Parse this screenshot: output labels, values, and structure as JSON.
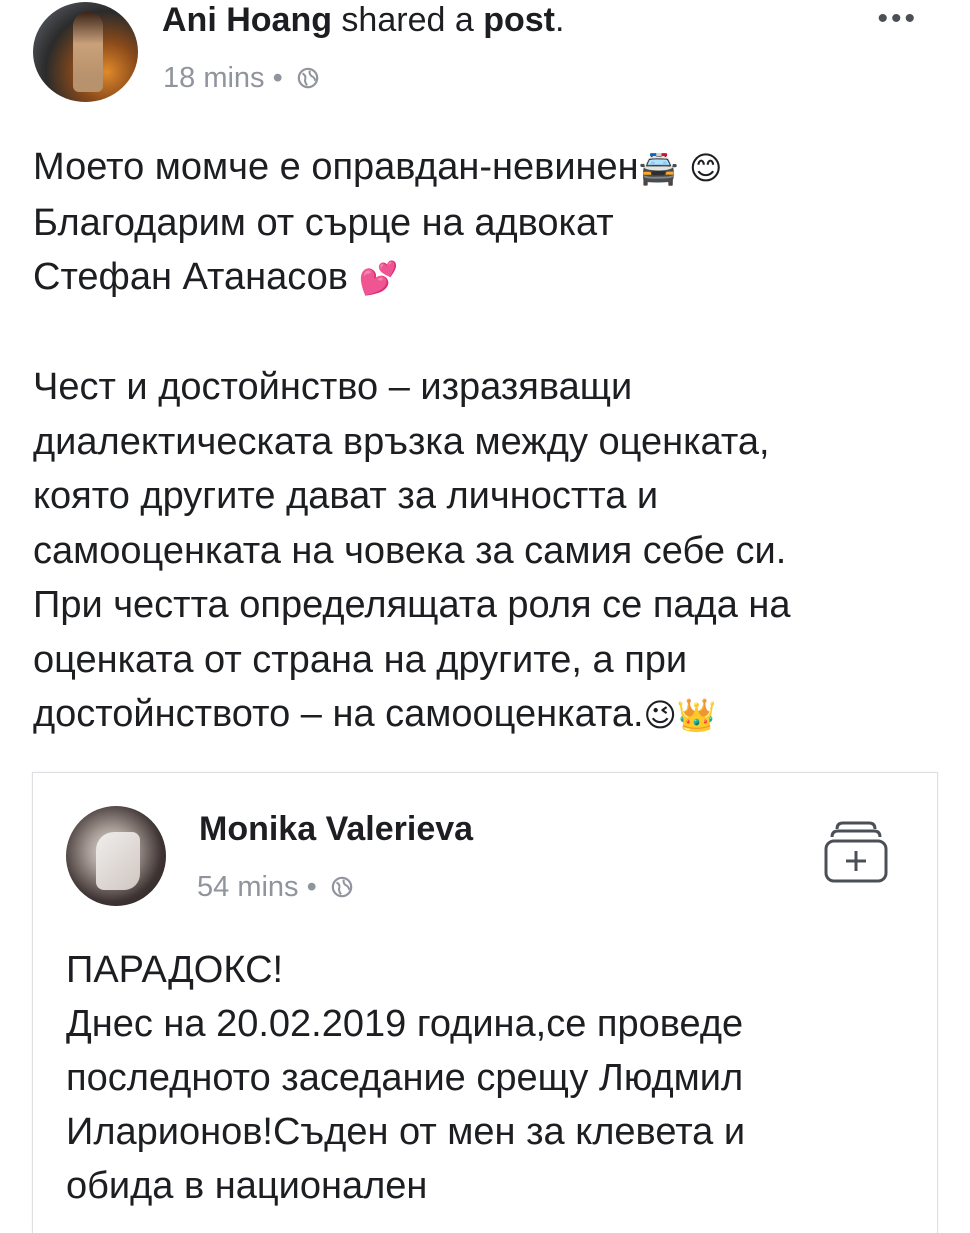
{
  "post": {
    "author": "Ani Hoang",
    "action_prefix": " shared a ",
    "action_object": "post",
    "action_suffix": ".",
    "time": "18 mins",
    "dot": " • ",
    "privacy_icon": "globe-icon",
    "more_label": "•••",
    "text_line1": "Моето момче е оправдан-невинен",
    "emoji1": "🚔",
    "emoji2": "😊",
    "text_line2": "Благодарим от сърце на адвокат",
    "text_line3": "Стефан Атанасов ",
    "emoji3": "💕",
    "paragraph2": "Чест и достойнство –  изразяващи\nдиалектическата връзка между оценката,\nкоято другите дават за личността и\nсамооценката на човека за самия себе си.\nПри честта определящата роля се пада на\nоценката от страна на другите, а при\nдостойнството – на самооценката.",
    "emoji4": "😉",
    "emoji5": "👑"
  },
  "shared": {
    "author": "Monika Valerieva",
    "time": "54 mins",
    "dot": " • ",
    "privacy_icon": "globe-icon",
    "save_icon": "save-collection-icon",
    "text": "ПАРАДОКС!\nДнес на 20.02.2019 година,се проведе\nпоследното заседание срещу Людмил\nИларионов!Съден от мен за клевета и\nобида в национален"
  }
}
